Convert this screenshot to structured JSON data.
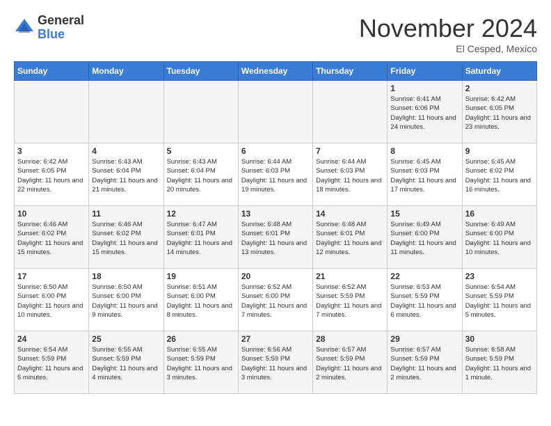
{
  "header": {
    "logo_general": "General",
    "logo_blue": "Blue",
    "month_title": "November 2024",
    "subtitle": "El Cesped, Mexico"
  },
  "days_of_week": [
    "Sunday",
    "Monday",
    "Tuesday",
    "Wednesday",
    "Thursday",
    "Friday",
    "Saturday"
  ],
  "weeks": [
    [
      {
        "day": "",
        "info": ""
      },
      {
        "day": "",
        "info": ""
      },
      {
        "day": "",
        "info": ""
      },
      {
        "day": "",
        "info": ""
      },
      {
        "day": "",
        "info": ""
      },
      {
        "day": "1",
        "info": "Sunrise: 6:41 AM\nSunset: 6:06 PM\nDaylight: 11 hours and 24 minutes."
      },
      {
        "day": "2",
        "info": "Sunrise: 6:42 AM\nSunset: 6:05 PM\nDaylight: 11 hours and 23 minutes."
      }
    ],
    [
      {
        "day": "3",
        "info": "Sunrise: 6:42 AM\nSunset: 6:05 PM\nDaylight: 11 hours and 22 minutes."
      },
      {
        "day": "4",
        "info": "Sunrise: 6:43 AM\nSunset: 6:04 PM\nDaylight: 11 hours and 21 minutes."
      },
      {
        "day": "5",
        "info": "Sunrise: 6:43 AM\nSunset: 6:04 PM\nDaylight: 11 hours and 20 minutes."
      },
      {
        "day": "6",
        "info": "Sunrise: 6:44 AM\nSunset: 6:03 PM\nDaylight: 11 hours and 19 minutes."
      },
      {
        "day": "7",
        "info": "Sunrise: 6:44 AM\nSunset: 6:03 PM\nDaylight: 11 hours and 18 minutes."
      },
      {
        "day": "8",
        "info": "Sunrise: 6:45 AM\nSunset: 6:03 PM\nDaylight: 11 hours and 17 minutes."
      },
      {
        "day": "9",
        "info": "Sunrise: 6:45 AM\nSunset: 6:02 PM\nDaylight: 11 hours and 16 minutes."
      }
    ],
    [
      {
        "day": "10",
        "info": "Sunrise: 6:46 AM\nSunset: 6:02 PM\nDaylight: 11 hours and 15 minutes."
      },
      {
        "day": "11",
        "info": "Sunrise: 6:46 AM\nSunset: 6:02 PM\nDaylight: 11 hours and 15 minutes."
      },
      {
        "day": "12",
        "info": "Sunrise: 6:47 AM\nSunset: 6:01 PM\nDaylight: 11 hours and 14 minutes."
      },
      {
        "day": "13",
        "info": "Sunrise: 6:48 AM\nSunset: 6:01 PM\nDaylight: 11 hours and 13 minutes."
      },
      {
        "day": "14",
        "info": "Sunrise: 6:48 AM\nSunset: 6:01 PM\nDaylight: 11 hours and 12 minutes."
      },
      {
        "day": "15",
        "info": "Sunrise: 6:49 AM\nSunset: 6:00 PM\nDaylight: 11 hours and 11 minutes."
      },
      {
        "day": "16",
        "info": "Sunrise: 6:49 AM\nSunset: 6:00 PM\nDaylight: 11 hours and 10 minutes."
      }
    ],
    [
      {
        "day": "17",
        "info": "Sunrise: 6:50 AM\nSunset: 6:00 PM\nDaylight: 11 hours and 10 minutes."
      },
      {
        "day": "18",
        "info": "Sunrise: 6:50 AM\nSunset: 6:00 PM\nDaylight: 11 hours and 9 minutes."
      },
      {
        "day": "19",
        "info": "Sunrise: 6:51 AM\nSunset: 6:00 PM\nDaylight: 11 hours and 8 minutes."
      },
      {
        "day": "20",
        "info": "Sunrise: 6:52 AM\nSunset: 6:00 PM\nDaylight: 11 hours and 7 minutes."
      },
      {
        "day": "21",
        "info": "Sunrise: 6:52 AM\nSunset: 5:59 PM\nDaylight: 11 hours and 7 minutes."
      },
      {
        "day": "22",
        "info": "Sunrise: 6:53 AM\nSunset: 5:59 PM\nDaylight: 11 hours and 6 minutes."
      },
      {
        "day": "23",
        "info": "Sunrise: 6:54 AM\nSunset: 5:59 PM\nDaylight: 11 hours and 5 minutes."
      }
    ],
    [
      {
        "day": "24",
        "info": "Sunrise: 6:54 AM\nSunset: 5:59 PM\nDaylight: 11 hours and 5 minutes."
      },
      {
        "day": "25",
        "info": "Sunrise: 6:55 AM\nSunset: 5:59 PM\nDaylight: 11 hours and 4 minutes."
      },
      {
        "day": "26",
        "info": "Sunrise: 6:55 AM\nSunset: 5:59 PM\nDaylight: 11 hours and 3 minutes."
      },
      {
        "day": "27",
        "info": "Sunrise: 6:56 AM\nSunset: 5:59 PM\nDaylight: 11 hours and 3 minutes."
      },
      {
        "day": "28",
        "info": "Sunrise: 6:57 AM\nSunset: 5:59 PM\nDaylight: 11 hours and 2 minutes."
      },
      {
        "day": "29",
        "info": "Sunrise: 6:57 AM\nSunset: 5:59 PM\nDaylight: 11 hours and 2 minutes."
      },
      {
        "day": "30",
        "info": "Sunrise: 6:58 AM\nSunset: 5:59 PM\nDaylight: 11 hours and 1 minute."
      }
    ]
  ]
}
